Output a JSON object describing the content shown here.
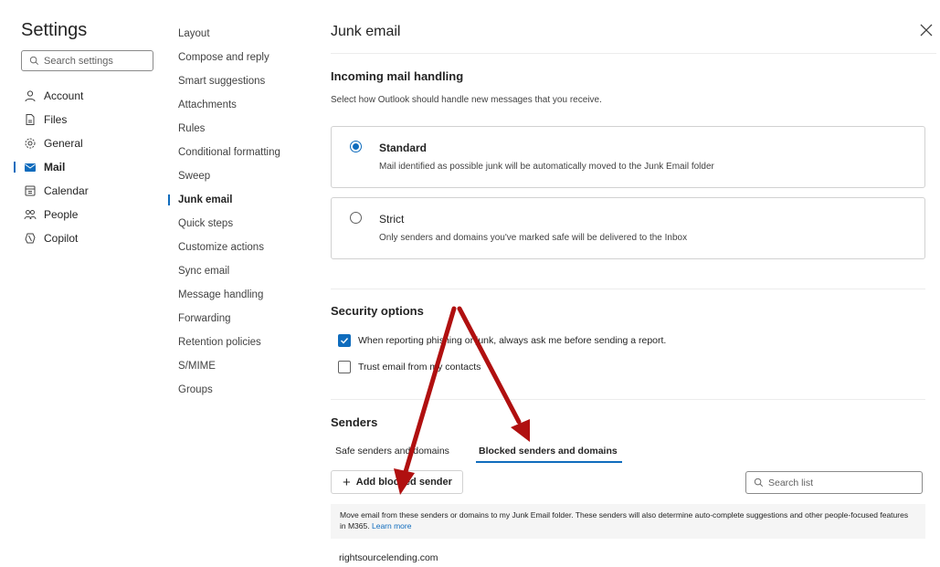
{
  "sidebar": {
    "title": "Settings",
    "search_placeholder": "Search settings",
    "items": [
      {
        "label": "Account"
      },
      {
        "label": "Files"
      },
      {
        "label": "General"
      },
      {
        "label": "Mail"
      },
      {
        "label": "Calendar"
      },
      {
        "label": "People"
      },
      {
        "label": "Copilot"
      }
    ]
  },
  "subnav": {
    "items": [
      {
        "label": "Layout"
      },
      {
        "label": "Compose and reply"
      },
      {
        "label": "Smart suggestions"
      },
      {
        "label": "Attachments"
      },
      {
        "label": "Rules"
      },
      {
        "label": "Conditional formatting"
      },
      {
        "label": "Sweep"
      },
      {
        "label": "Junk email"
      },
      {
        "label": "Quick steps"
      },
      {
        "label": "Customize actions"
      },
      {
        "label": "Sync email"
      },
      {
        "label": "Message handling"
      },
      {
        "label": "Forwarding"
      },
      {
        "label": "Retention policies"
      },
      {
        "label": "S/MIME"
      },
      {
        "label": "Groups"
      }
    ]
  },
  "main": {
    "title": "Junk email",
    "incoming": {
      "heading": "Incoming mail handling",
      "description": "Select how Outlook should handle new messages that you receive.",
      "options": [
        {
          "title": "Standard",
          "desc": "Mail identified as possible junk will be automatically moved to the Junk Email folder"
        },
        {
          "title": "Strict",
          "desc": "Only senders and domains you've marked safe will be delivered to the Inbox"
        }
      ]
    },
    "security": {
      "heading": "Security options",
      "options": [
        {
          "label": "When reporting phishing or junk, always ask me before sending a report."
        },
        {
          "label": "Trust email from my contacts"
        }
      ]
    },
    "senders": {
      "heading": "Senders",
      "tabs": [
        {
          "label": "Safe senders and domains"
        },
        {
          "label": "Blocked senders and domains"
        }
      ],
      "add_button": "Add blocked sender",
      "search_placeholder": "Search list",
      "info_text": "Move email from these senders or domains to my Junk Email folder. These senders will also determine auto-complete suggestions and other people-focused features in M365.",
      "info_link": "Learn more",
      "list": [
        "rightsourcelending.com"
      ]
    }
  },
  "colors": {
    "accent": "#0f6cbd",
    "annotation_arrow": "#b01010"
  }
}
